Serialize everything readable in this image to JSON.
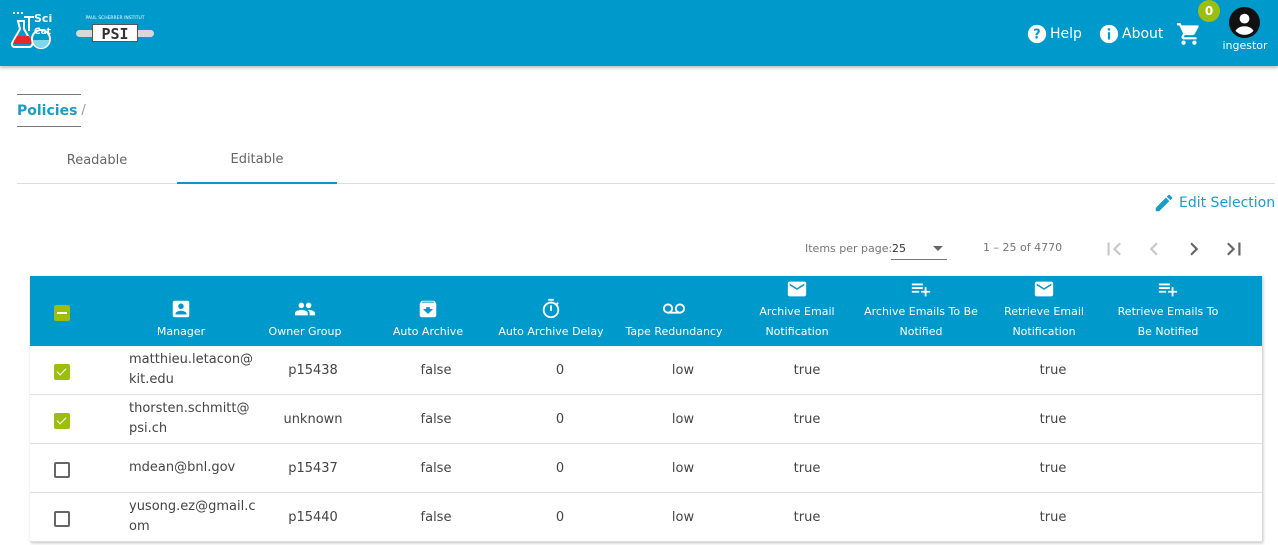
{
  "header": {
    "logo_scicat_alt": "SciCat",
    "logo_psi_alt": "Paul Scherrer Institut PSI",
    "help_label": "Help",
    "about_label": "About",
    "cart_count": "0",
    "user_name": "ingestor",
    "colors": {
      "bar": "#0099cc",
      "badge": "#9cbe0e"
    }
  },
  "breadcrumb": {
    "items": [
      "Policies"
    ],
    "separator": "/"
  },
  "tabs": [
    {
      "label": "Readable",
      "active": false
    },
    {
      "label": "Editable",
      "active": true
    }
  ],
  "actions": {
    "edit_selection_label": "Edit Selection"
  },
  "paginator": {
    "items_per_page_label": "Items per page:",
    "items_per_page_value": "25",
    "range_label": "1 – 25 of 4770",
    "first_page_enabled": false,
    "prev_page_enabled": false,
    "next_page_enabled": true,
    "last_page_enabled": true
  },
  "table": {
    "select_all_state": "indeterminate",
    "columns": [
      {
        "key": "manager",
        "label": "Manager",
        "icon": "account-box-icon"
      },
      {
        "key": "ownerGroup",
        "label": "Owner Group",
        "icon": "group-icon"
      },
      {
        "key": "autoArchive",
        "label": "Auto Archive",
        "icon": "archive-icon"
      },
      {
        "key": "autoArchiveDelay",
        "label": "Auto Archive Delay",
        "icon": "timer-icon"
      },
      {
        "key": "tapeRedundancy",
        "label": "Tape Redundancy",
        "icon": "voicemail-icon"
      },
      {
        "key": "archiveEmailNotification",
        "label": "Archive Email Notification",
        "icon": "email-icon"
      },
      {
        "key": "archiveEmailsToBeNotified",
        "label": "Archive Emails To Be Notified",
        "icon": "playlist-add-icon"
      },
      {
        "key": "retrieveEmailNotification",
        "label": "Retrieve Email Notification",
        "icon": "email-icon"
      },
      {
        "key": "retrieveEmailsToBeNotified",
        "label": "Retrieve Emails To Be Notified",
        "icon": "playlist-add-icon"
      }
    ],
    "rows": [
      {
        "selected": true,
        "manager": "matthieu.letacon@kit.edu",
        "ownerGroup": "p15438",
        "autoArchive": "false",
        "autoArchiveDelay": "0",
        "tapeRedundancy": "low",
        "archiveEmailNotification": "true",
        "archiveEmailsToBeNotified": "",
        "retrieveEmailNotification": "true",
        "retrieveEmailsToBeNotified": ""
      },
      {
        "selected": true,
        "manager": "thorsten.schmitt@psi.ch",
        "ownerGroup": "unknown",
        "autoArchive": "false",
        "autoArchiveDelay": "0",
        "tapeRedundancy": "low",
        "archiveEmailNotification": "true",
        "archiveEmailsToBeNotified": "",
        "retrieveEmailNotification": "true",
        "retrieveEmailsToBeNotified": ""
      },
      {
        "selected": false,
        "manager": "mdean@bnl.gov",
        "ownerGroup": "p15437",
        "autoArchive": "false",
        "autoArchiveDelay": "0",
        "tapeRedundancy": "low",
        "archiveEmailNotification": "true",
        "archiveEmailsToBeNotified": "",
        "retrieveEmailNotification": "true",
        "retrieveEmailsToBeNotified": ""
      },
      {
        "selected": false,
        "manager": "yusong.ez@gmail.com",
        "ownerGroup": "p15440",
        "autoArchive": "false",
        "autoArchiveDelay": "0",
        "tapeRedundancy": "low",
        "archiveEmailNotification": "true",
        "archiveEmailsToBeNotified": "",
        "retrieveEmailNotification": "true",
        "retrieveEmailsToBeNotified": ""
      }
    ]
  }
}
